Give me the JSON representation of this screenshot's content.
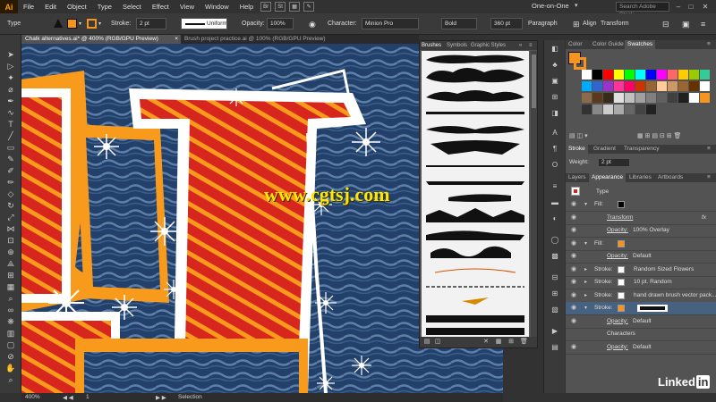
{
  "app": {
    "logo": "Ai",
    "title_search_placeholder": "Search Adobe Stock"
  },
  "menu": [
    "File",
    "Edit",
    "Object",
    "Type",
    "Select",
    "Effect",
    "View",
    "Window",
    "Help"
  ],
  "menu_icons": [
    "Br",
    "St"
  ],
  "workspace": "One-on-One",
  "window_controls": [
    "–",
    "□",
    "✕"
  ],
  "control_bar": {
    "selection_type": "Type",
    "stroke_label": "Stroke:",
    "stroke_value": "2 pt",
    "stroke_profile": "Uniform",
    "opacity_label": "Opacity:",
    "opacity_value": "100%",
    "character_label": "Character:",
    "font": "Minion Pro",
    "style": "Bold",
    "size": "360 pt",
    "paragraph": "Paragraph",
    "align": "Align",
    "transform": "Transform"
  },
  "tabs": [
    {
      "label": "Chalk alternatives.ai* @ 400% (RGB/GPU Preview)",
      "active": true
    },
    {
      "label": "Brush project practice.ai @ 100% (RGB/GPU Preview)",
      "active": false
    }
  ],
  "tools": [
    "selection",
    "direct-selection",
    "magic-wand",
    "lasso",
    "pen",
    "curvature",
    "type",
    "line",
    "rectangle",
    "paintbrush",
    "shaper",
    "pencil",
    "eraser",
    "rotate",
    "scale",
    "width",
    "free-transform",
    "shape-builder",
    "perspective",
    "mesh",
    "gradient",
    "eyedropper",
    "blend",
    "symbol-sprayer",
    "column-graph",
    "artboard",
    "slice",
    "hand",
    "zoom"
  ],
  "brushes_panel": {
    "tabs": [
      "Brushes",
      "Symbols",
      "Graphic Styles"
    ],
    "bottom_icons": [
      "library",
      "brush-options",
      "remove-stroke",
      "new-brush",
      "delete"
    ]
  },
  "color_panel": {
    "tabs": [
      "Color",
      "Color Guide",
      "Swatches"
    ],
    "swatch_colors": [
      [
        "#ffffff",
        "#000000",
        "#ff0000",
        "#ffff00",
        "#00ff00",
        "#00ffff",
        "#0000ff",
        "#ff00ff",
        "#ff6666",
        "#ffcc00",
        "#99cc00",
        "#33cc99"
      ],
      [
        "#00aaff",
        "#3366cc",
        "#9933cc",
        "#ff3399",
        "#ff0066",
        "#cc3300",
        "#996633",
        "#ffcc99",
        "#cc9966",
        "#996633",
        "#663300",
        "#ffffff"
      ],
      [
        "#8a6a4a",
        "#5a3a1a",
        "#3a2a1a",
        "#e0e0e0",
        "#c0c0c0",
        "#a0a0a0",
        "#808080",
        "#606060",
        "#404040",
        "#202020",
        "#ffffff",
        "#f7941d"
      ],
      [
        "#333333",
        "#888888",
        "#cccccc",
        "#aaaaaa",
        "#666666",
        "#444444",
        "#222222"
      ]
    ]
  },
  "stroke_panel": {
    "tabs": [
      "Stroke",
      "Gradient",
      "Transparency"
    ],
    "weight_label": "Weight:",
    "weight_value": "2 pt"
  },
  "appearance_panel": {
    "tabs": [
      "Layers",
      "Appearance",
      "Libraries",
      "Artboards"
    ],
    "header": "Type",
    "rows": [
      {
        "kind": "fill",
        "label": "Fill:",
        "swatch": "#000000"
      },
      {
        "kind": "sub",
        "label": "Transform",
        "fx": "fx",
        "underline": true
      },
      {
        "kind": "sub",
        "label": "Opacity:",
        "value": "100% Overlay",
        "underline": true
      },
      {
        "kind": "fill",
        "label": "Fill:",
        "swatch": "#f7941d"
      },
      {
        "kind": "sub",
        "label": "Opacity:",
        "value": "Default",
        "underline": true
      },
      {
        "kind": "stroke",
        "label": "Stroke:",
        "value": "Random Sized Flowers"
      },
      {
        "kind": "stroke",
        "label": "Stroke:",
        "value": "10 pt. Random"
      },
      {
        "kind": "stroke",
        "label": "Stroke:",
        "value": "hand drawn brush vector pack..."
      },
      {
        "kind": "stroke-active",
        "label": "Stroke:",
        "swatch": "#f7941d"
      },
      {
        "kind": "sub",
        "label": "Opacity:",
        "value": "Default",
        "underline": true
      },
      {
        "kind": "plain",
        "label": "Characters"
      },
      {
        "kind": "sub",
        "label": "Opacity:",
        "value": "Default",
        "underline": true
      }
    ]
  },
  "status": {
    "zoom": "400%",
    "artboard": "1",
    "tool": "Selection"
  },
  "watermark": "www.cgtsj.com",
  "brand": {
    "name": "Linked",
    "in": "in"
  },
  "colors": {
    "accent": "#f7941d",
    "canvas_blue": "#22406a",
    "stripe_red": "#d7261e",
    "stripe_orange": "#f89a1c"
  }
}
